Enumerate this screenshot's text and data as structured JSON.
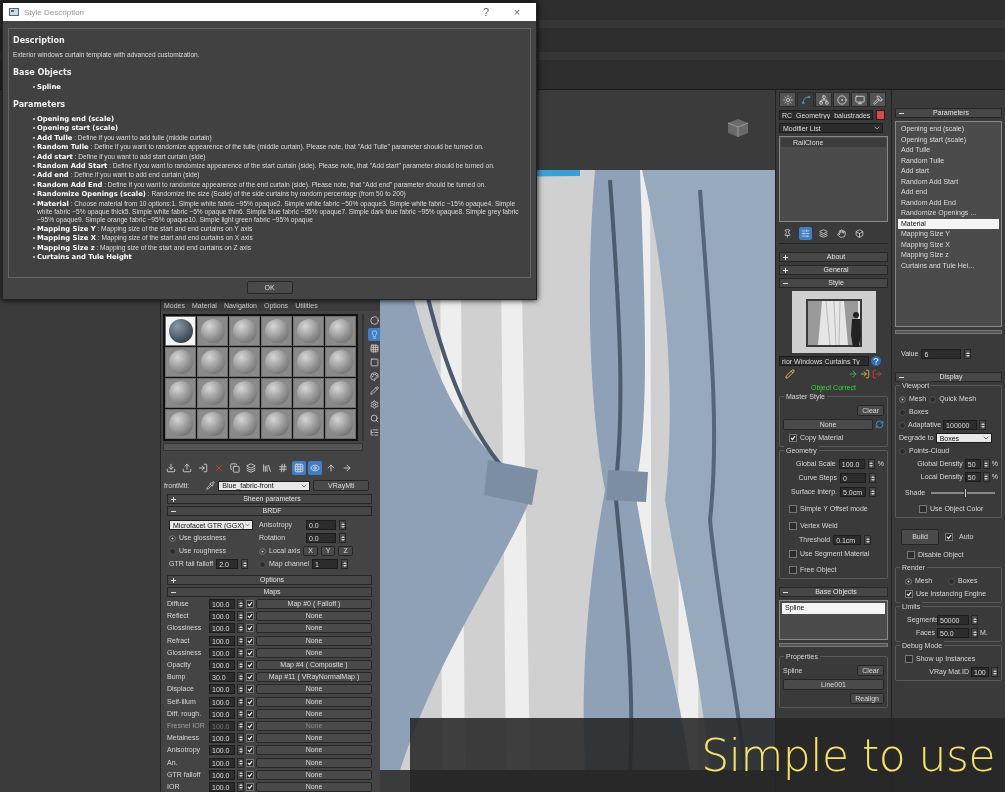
{
  "dialog": {
    "title": "Style Description",
    "help": "?",
    "close": "×",
    "description_heading": "Description",
    "description": "Exterior windows curtain template with advanced customization.",
    "base_objects_heading": "Base Objects",
    "base_objects": [
      {
        "name": "Spline"
      }
    ],
    "parameters_heading": "Parameters",
    "parameters": [
      {
        "name": "Opening end (scale)"
      },
      {
        "name": "Opening start (scale)"
      },
      {
        "name": "Add Tulle",
        "text": ": Define if you want to add tulle (middle curtain)"
      },
      {
        "name": "Random Tulle",
        "text": ": Define if you want to randomize appearence of the tulle (middle curtain). Please note, that \"Add Tulle\" parameter should be turned on."
      },
      {
        "name": "Add start",
        "text": ": Define if you want to add start curtain (side)"
      },
      {
        "name": "Random Add Start",
        "text": ": Define if you want to randomize appearence of the start curtain (side). Please note, that \"Add start\" parameter should be turned on."
      },
      {
        "name": "Add end",
        "text": ": Define if you want to add end curtain (side)"
      },
      {
        "name": "Random Add End",
        "text": ": Define if you want to randomize appearence of the end curtain (side). Please note, that \"Add end\" parameter should be turned on."
      },
      {
        "name": "Randomize Openings (scale)",
        "text": ": Randomize the size (Scale) of the side curtains by random percentage (from 50 to 200)"
      },
      {
        "name": "Material",
        "text": ": Choose material from 10 options:1. Simple white fabric ~95% opaque2. Simple white fabric ~50% opaque3. Simple white fabric ~15% opaque4. Simple white fabric ~5% opaque thick5. Simple white fabric ~5% opaque thin6. Simple blue fabric ~95% opaque7. Simple dark blue fabric ~95% opaque8. Simple grey fabric ~95% opaque9. Simple orange fabric ~95% opaque10. Simple light green fabric ~95% opaque"
      },
      {
        "name": "Mapping Size Y",
        "text": ": Mapping size of the start and end curtains on Y axis"
      },
      {
        "name": "Mapping Size X",
        "text": ": Mapping size of the start and end curtains on X axis"
      },
      {
        "name": "Mapping Size z",
        "text": ": Mapping size of the start and end curtains on Z axis"
      },
      {
        "name": "Curtains and Tule Height"
      }
    ],
    "ok": "OK"
  },
  "material_editor": {
    "menu": [
      "Modes",
      "Material",
      "Navigation",
      "Options",
      "Utilities"
    ],
    "samples": [
      {
        "selected": true
      },
      {
        "selected": false
      },
      {
        "selected": false
      },
      {
        "selected": false
      },
      {
        "selected": false
      },
      {
        "selected": false
      },
      {
        "selected": false
      },
      {
        "selected": false
      },
      {
        "selected": false
      },
      {
        "selected": false
      },
      {
        "selected": false
      },
      {
        "selected": false
      },
      {
        "selected": false
      },
      {
        "selected": false
      },
      {
        "selected": false
      },
      {
        "selected": false
      },
      {
        "selected": false
      },
      {
        "selected": false
      },
      {
        "selected": false
      },
      {
        "selected": false
      },
      {
        "selected": false
      },
      {
        "selected": false
      },
      {
        "selected": false
      },
      {
        "selected": false
      }
    ],
    "side_tools": [
      {
        "kind": "sphere",
        "on": false
      },
      {
        "kind": "backlight",
        "on": true
      },
      {
        "kind": "checker",
        "on": false
      },
      {
        "kind": "box",
        "on": false
      },
      {
        "kind": "colors",
        "on": false
      },
      {
        "kind": "pen",
        "on": false
      },
      {
        "kind": "gear",
        "on": false
      },
      {
        "kind": "magnify",
        "on": false
      },
      {
        "kind": "tree",
        "on": false
      }
    ],
    "toolbar": [
      {
        "kind": "get",
        "on": false
      },
      {
        "kind": "put",
        "on": false
      },
      {
        "kind": "assign",
        "on": false
      },
      {
        "kind": "reset",
        "on": false
      },
      {
        "kind": "copy",
        "on": false
      },
      {
        "kind": "unique",
        "on": false
      },
      {
        "kind": "library",
        "on": false
      },
      {
        "kind": "channel",
        "on": false
      },
      {
        "kind": "shaded",
        "on": true
      },
      {
        "kind": "result",
        "on": true
      },
      {
        "kind": "parent",
        "on": false
      },
      {
        "kind": "forward",
        "on": false
      }
    ],
    "slot_label": "frontMtl:",
    "material_name": "Blue_fabric-front",
    "material_type": "VRayMtl",
    "sheen": {
      "label": "Sheen parameters",
      "expanded": false
    },
    "brdf": {
      "label": "BRDF",
      "expanded": true,
      "type": "Microfacet GTR (GGX)",
      "options": [
        {
          "label": "Use glossiness",
          "selected": true
        },
        {
          "label": "Use roughness",
          "selected": false
        }
      ],
      "anisotropy_label": "Anisotropy",
      "anisotropy": "0.0",
      "rotation_label": "Rotation",
      "rotation": "0.0",
      "axis_options": [
        {
          "label": "Local axis",
          "selected": true
        },
        {
          "label": "Map channel",
          "selected": false
        }
      ],
      "axes": [
        "X",
        "Y",
        "Z"
      ],
      "map_channel": "1",
      "gtr_label": "GTR tail falloff",
      "gtr": "2.0"
    },
    "options_rollout": {
      "label": "Options",
      "expanded": false
    },
    "maps": {
      "label": "Maps",
      "expanded": true,
      "rows": [
        {
          "label": "Diffuse",
          "amount": "100.0",
          "checked": true,
          "map": "Map #0 ( Falloff )",
          "disabled": false
        },
        {
          "label": "Reflect",
          "amount": "100.0",
          "checked": true,
          "map": "None",
          "disabled": false
        },
        {
          "label": "Glossiness",
          "amount": "100.0",
          "checked": true,
          "map": "None",
          "disabled": false
        },
        {
          "label": "Refract",
          "amount": "100.0",
          "checked": true,
          "map": "None",
          "disabled": false
        },
        {
          "label": "Glossiness",
          "amount": "100.0",
          "checked": true,
          "map": "None",
          "disabled": false
        },
        {
          "label": "Opacity",
          "amount": "100.0",
          "checked": true,
          "map": "Map #4 ( Composite )",
          "disabled": false
        },
        {
          "label": "Bump",
          "amount": "30.0",
          "checked": true,
          "map": "Map #11 ( VRayNormalMap )",
          "disabled": false
        },
        {
          "label": "Displace",
          "amount": "100.0",
          "checked": true,
          "map": "None",
          "disabled": false
        },
        {
          "label": "Self-illum",
          "amount": "100.0",
          "checked": true,
          "map": "None",
          "disabled": false
        },
        {
          "label": "Diff. rough.",
          "amount": "100.0",
          "checked": true,
          "map": "None",
          "disabled": false
        },
        {
          "label": "Fresnel IOR",
          "amount": "100.0",
          "checked": true,
          "map": "None",
          "disabled": true
        },
        {
          "label": "Metalness",
          "amount": "100.0",
          "checked": true,
          "map": "None",
          "disabled": false
        },
        {
          "label": "Anisotropy",
          "amount": "100.0",
          "checked": true,
          "map": "None",
          "disabled": false
        },
        {
          "label": "An.",
          "amount": "100.0",
          "checked": true,
          "map": "None",
          "disabled": false
        },
        {
          "label": "GTR falloff",
          "amount": "100.0",
          "checked": true,
          "map": "None",
          "disabled": false
        },
        {
          "label": "IOR",
          "amount": "100.0",
          "checked": true,
          "map": "None",
          "disabled": false
        }
      ]
    }
  },
  "command_panel": {
    "tabs": [
      {
        "kind": "create",
        "selected": false
      },
      {
        "kind": "modify",
        "selected": true
      },
      {
        "kind": "hierarchy",
        "selected": false
      },
      {
        "kind": "motion",
        "selected": false
      },
      {
        "kind": "display",
        "selected": false
      },
      {
        "kind": "utilities",
        "selected": false
      }
    ],
    "object_name": "RC_Geometryy_balustrades",
    "modifier_list": "Modifier List",
    "stack": [
      {
        "name": "RailClone"
      }
    ],
    "stack_tools": [
      {
        "kind": "pin",
        "on": false
      },
      {
        "kind": "result",
        "on": true
      },
      {
        "kind": "unique",
        "on": false
      },
      {
        "kind": "hand",
        "on": false
      },
      {
        "kind": "configure",
        "on": false
      }
    ],
    "about": {
      "label": "About",
      "expanded": false
    },
    "general": {
      "label": "General",
      "expanded": false
    },
    "style": {
      "label": "Style",
      "expanded": true,
      "name": "rior Windows Curtains Ty",
      "status": "Object Correct",
      "master_label": "Master Style",
      "clear": "Clear",
      "master": "None",
      "copy_material": {
        "label": "Copy Material",
        "checked": true
      },
      "geometry_label": "Geometry",
      "geometry_fields": [
        {
          "label": "Global Scale",
          "value": "100.0",
          "unit": "%"
        },
        {
          "label": "Curve Steps",
          "value": "0"
        },
        {
          "label": "Surface Interp.",
          "value": "5.0cm"
        }
      ],
      "simple_y": {
        "label": "Simple Y Offset mode",
        "checked": false
      },
      "vertex_weld": {
        "label": "Vertex Weld",
        "checked": false
      },
      "threshold_label": "Threshold",
      "threshold": "0.1cm",
      "segment_material": {
        "label": "Use Segment Material",
        "checked": false
      },
      "free_object": {
        "label": "Free Object",
        "checked": false
      }
    },
    "base_objects": {
      "label": "Base Objects",
      "expanded": true,
      "items": [
        {
          "name": "Spline",
          "selected": true
        }
      ],
      "properties_label": "Properties",
      "spline_label": "Spline",
      "clear": "Clear",
      "line": "Line001",
      "realign": "Realign"
    },
    "parameters": {
      "label": "Parameters",
      "expanded": true,
      "items": [
        {
          "name": "Opening end (scale)",
          "selected": false
        },
        {
          "name": "Opening start (scale)",
          "selected": false
        },
        {
          "name": "Add Tulle",
          "selected": false
        },
        {
          "name": "Random Tulle",
          "selected": false
        },
        {
          "name": "Add start",
          "selected": false
        },
        {
          "name": "Random Add Start",
          "selected": false
        },
        {
          "name": "Add end",
          "selected": false
        },
        {
          "name": "Random Add End",
          "selected": false
        },
        {
          "name": "Randomize Openings ...",
          "selected": false
        },
        {
          "name": "Material",
          "selected": true
        },
        {
          "name": "Mapping Size Y",
          "selected": false
        },
        {
          "name": "Mapping Size X",
          "selected": false
        },
        {
          "name": "Mapping Size z",
          "selected": false
        },
        {
          "name": "Curtains and Tule Hei...",
          "selected": false
        }
      ],
      "value_label": "Value",
      "value": "6"
    },
    "display": {
      "label": "Display",
      "expanded": true,
      "viewport_label": "Viewport",
      "modes": [
        {
          "label": "Mesh",
          "selected": true
        },
        {
          "label": "Quick Mesh",
          "selected": false
        },
        {
          "label": "Boxes",
          "selected": false
        },
        {
          "label": "Adaptative",
          "selected": false
        },
        {
          "label": "Points-Cloud",
          "selected": false
        }
      ],
      "adaptative_value": "100000",
      "degrade_label": "Degrade to",
      "degrade": "Boxes",
      "global_density_label": "Global Density",
      "global_density": "50",
      "local_density_label": "Local Density",
      "local_density": "50",
      "percent": "%",
      "shade_label": "Shade",
      "shade": {
        "level": 0.55
      },
      "object_color": {
        "label": "Use Object Color",
        "checked": false
      },
      "build": "Build",
      "auto": {
        "label": "Auto",
        "checked": true
      },
      "disable": {
        "label": "Disable Object",
        "checked": false
      },
      "render_label": "Render",
      "render_modes": [
        {
          "label": "Mesh",
          "selected": true
        },
        {
          "label": "Boxes",
          "selected": false
        }
      ],
      "instancing": {
        "label": "Use Instancing Engine",
        "checked": true
      },
      "limits_label": "Limits",
      "segments_label": "Segments",
      "segments": "50000",
      "faces_label": "Faces",
      "faces": "50.0",
      "faces_unit": "M.",
      "debug_label": "Debug Mode",
      "show_instances": {
        "label": "Show up Instances",
        "checked": false
      },
      "mat_id_label": "VRay Mat.ID",
      "mat_id": "100"
    }
  },
  "banner": {
    "text": "Simple to use"
  }
}
